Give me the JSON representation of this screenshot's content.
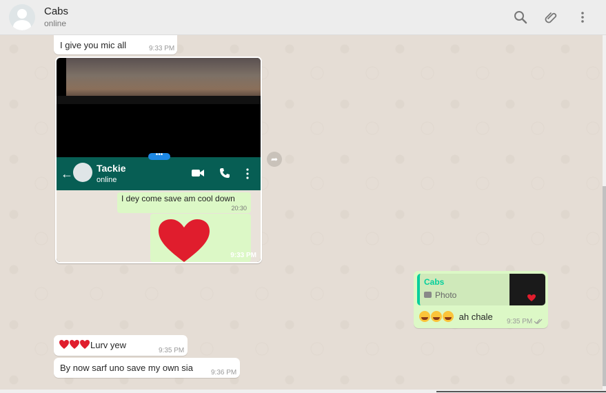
{
  "header": {
    "name": "Cabs",
    "status": "online"
  },
  "icons": [
    "search-icon",
    "attach-icon",
    "menu-icon",
    "forward-icon"
  ],
  "messages": {
    "m1": {
      "text": "I give you mic all",
      "time": "9:33 PM"
    },
    "photo": {
      "time": "9:33 PM",
      "embedded_contact": "Tackie",
      "embedded_status": "online",
      "embedded_message": "I dey come save am cool down",
      "embedded_time": "20:30"
    },
    "reply": {
      "quoted_name": "Cabs",
      "quoted_type": "Photo",
      "text": "ah chale",
      "time": "9:35 PM"
    },
    "m3": {
      "text": "Lurv yew",
      "time": "9:35 PM"
    },
    "m4": {
      "text": "By now sarf uno save my own sia",
      "time": "9:36 PM"
    }
  },
  "colors": {
    "outgoing": "#dcf8c6",
    "incoming": "#ffffff",
    "accent": "#06cf9c",
    "wa_green": "#075e54"
  }
}
